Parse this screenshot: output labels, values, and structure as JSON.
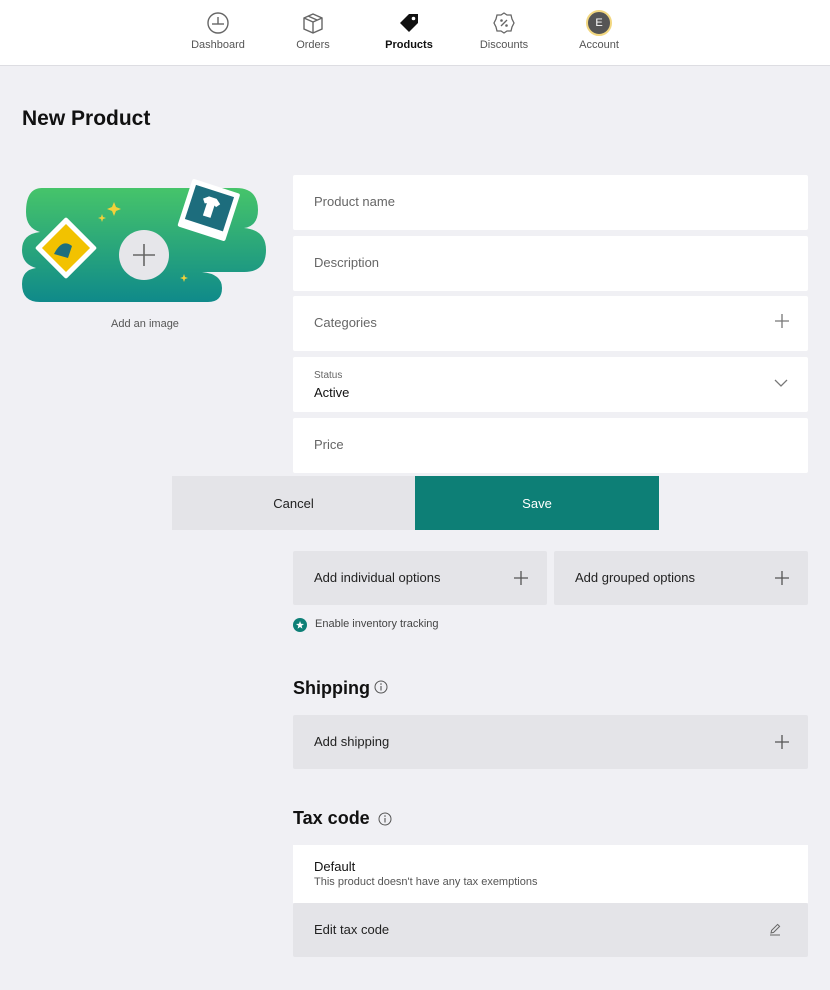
{
  "nav": {
    "items": [
      {
        "label": "Dashboard",
        "icon": "dashboard-icon"
      },
      {
        "label": "Orders",
        "icon": "box-icon"
      },
      {
        "label": "Products",
        "icon": "tag-icon",
        "active": true
      },
      {
        "label": "Discounts",
        "icon": "percent-badge-icon"
      },
      {
        "label": "Account",
        "icon": "avatar"
      }
    ],
    "avatar_initial": "E"
  },
  "page": {
    "title": "New Product"
  },
  "image_upload": {
    "label": "Add an image"
  },
  "form": {
    "product_name_placeholder": "Product name",
    "description_placeholder": "Description",
    "categories_placeholder": "Categories",
    "status_label": "Status",
    "status_value": "Active",
    "price_placeholder": "Price"
  },
  "actions": {
    "cancel": "Cancel",
    "save": "Save"
  },
  "options": {
    "add_individual": "Add individual options",
    "add_grouped": "Add grouped options",
    "inventory_tracking": "Enable inventory tracking"
  },
  "shipping": {
    "title": "Shipping",
    "add_label": "Add shipping"
  },
  "tax": {
    "title": "Tax code",
    "default_title": "Default",
    "default_desc": "This product doesn't have any tax exemptions",
    "edit_label": "Edit tax code"
  },
  "colors": {
    "accent": "#0d7f76",
    "background": "#f0f0f4",
    "button_grey": "#e4e4e8"
  }
}
